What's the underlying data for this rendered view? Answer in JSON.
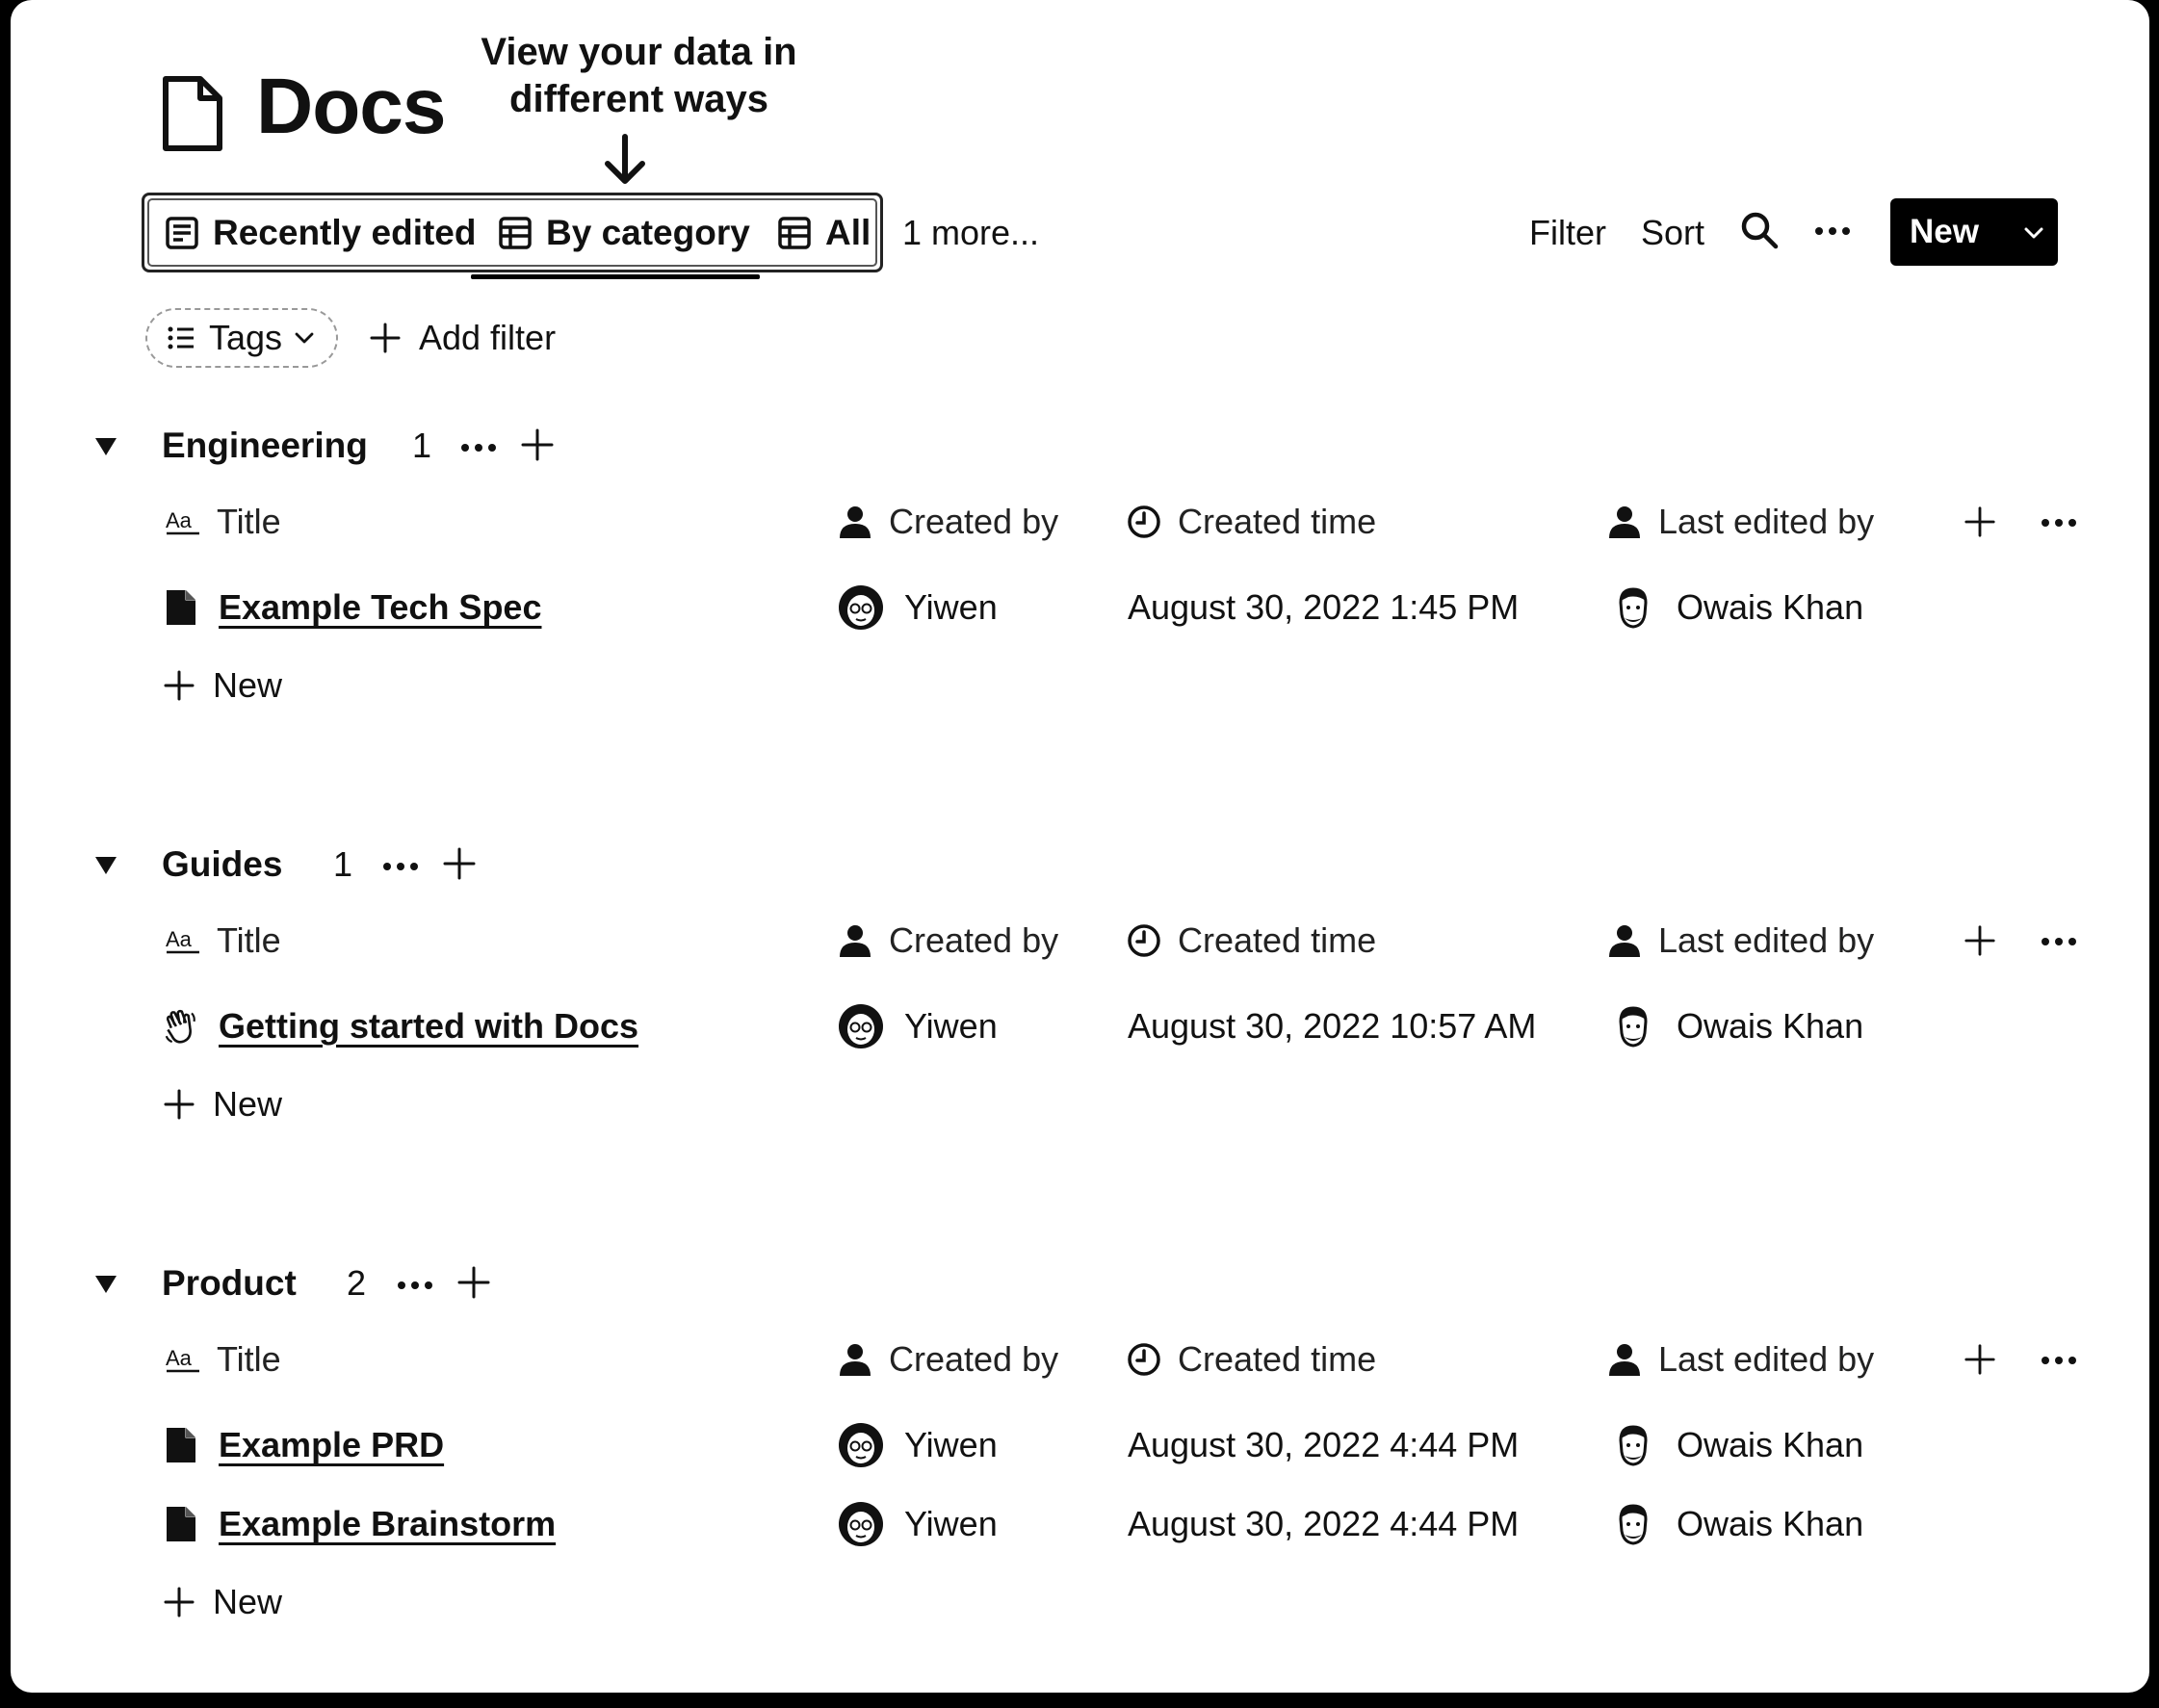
{
  "page": {
    "title": "Docs"
  },
  "annotation": {
    "text": "View your data in different ways"
  },
  "views": {
    "tabs": [
      {
        "label": "Recently edited",
        "icon": "list-view-icon"
      },
      {
        "label": "By category",
        "icon": "table-icon",
        "active": true
      },
      {
        "label": "All",
        "icon": "table-icon"
      }
    ],
    "more": "1 more..."
  },
  "toolbar": {
    "filter": "Filter",
    "sort": "Sort",
    "new_label": "New"
  },
  "filters": {
    "tags_label": "Tags",
    "add_filter_label": "Add filter"
  },
  "columns": {
    "title": "Title",
    "created_by": "Created by",
    "created_time": "Created time",
    "last_edited_by": "Last edited by"
  },
  "add_row_label": "New",
  "groups": [
    {
      "name": "Engineering",
      "count": "1",
      "rows": [
        {
          "title": "Example Tech Spec",
          "icon": "page-icon",
          "created_by": "Yiwen",
          "created_time": "August 30, 2022 1:45 PM",
          "last_edited_by": "Owais Khan"
        }
      ]
    },
    {
      "name": "Guides",
      "count": "1",
      "rows": [
        {
          "title": "Getting started with Docs",
          "icon": "waving-hand-icon",
          "created_by": "Yiwen",
          "created_time": "August 30, 2022 10:57 AM",
          "last_edited_by": "Owais Khan"
        }
      ]
    },
    {
      "name": "Product",
      "count": "2",
      "rows": [
        {
          "title": "Example PRD",
          "icon": "page-icon",
          "created_by": "Yiwen",
          "created_time": "August 30, 2022 4:44 PM",
          "last_edited_by": "Owais Khan"
        },
        {
          "title": "Example Brainstorm",
          "icon": "page-icon",
          "created_by": "Yiwen",
          "created_time": "August 30, 2022 4:44 PM",
          "last_edited_by": "Owais Khan"
        }
      ]
    }
  ]
}
